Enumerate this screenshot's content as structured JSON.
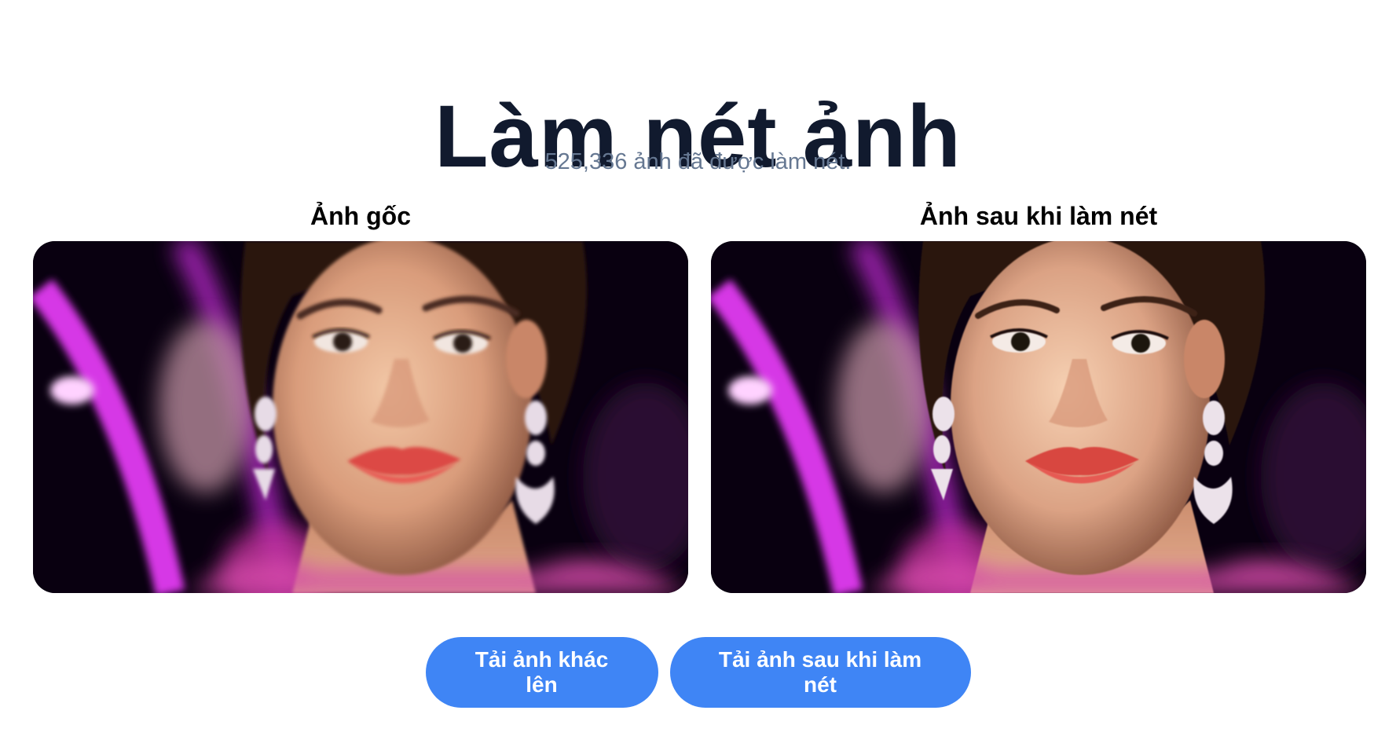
{
  "header": {
    "title": "Làm nét ảnh",
    "subtitle": "525,336 ảnh đã được làm nét."
  },
  "panels": {
    "original_label": "Ảnh gốc",
    "enhanced_label": "Ảnh sau khi làm nét"
  },
  "actions": {
    "upload_label": "Tải ảnh khác lên",
    "download_label": "Tải ảnh sau khi làm nét"
  },
  "colors": {
    "title": "#111a2e",
    "subtitle": "#667892",
    "button": "#3f85f5",
    "neon": "#e23bf2",
    "backdrop": "#090010"
  }
}
